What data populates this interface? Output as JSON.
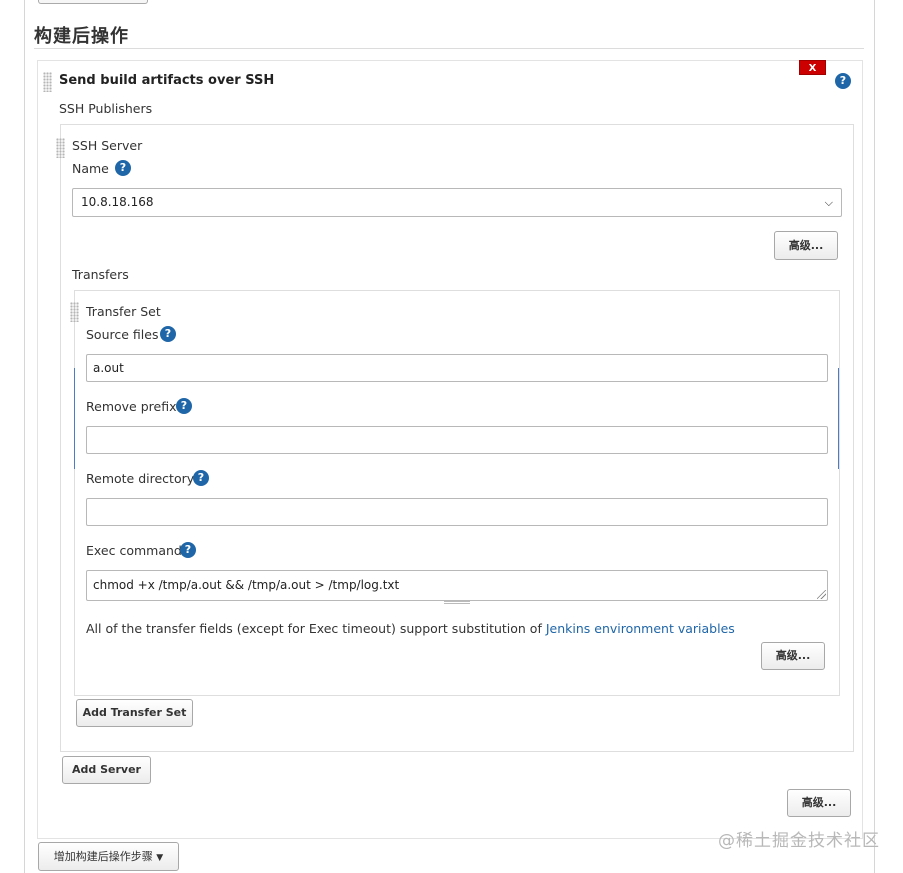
{
  "section": {
    "title": "构建后操作"
  },
  "publisher": {
    "title": "Send build artifacts over SSH",
    "delete_label": "X",
    "help": "?",
    "publishers_label": "SSH Publishers"
  },
  "ssh_server": {
    "title": "SSH Server",
    "name_label": "Name",
    "name_value": "10.8.18.168",
    "advanced_label": "高级..."
  },
  "transfers": {
    "label": "Transfers",
    "set_title": "Transfer Set",
    "source_files_label": "Source files",
    "source_files_value": "a.out",
    "remove_prefix_label": "Remove prefix",
    "remove_prefix_value": "",
    "remote_directory_label": "Remote directory",
    "remote_directory_value": "",
    "exec_command_label": "Exec command",
    "exec_command_value": "chmod +x /tmp/a.out && /tmp/a.out > /tmp/log.txt",
    "note_prefix": "All of the transfer fields (except for Exec timeout) support substitution of",
    "note_link": "Jenkins environment variables",
    "advanced_label": "高级...",
    "add_transfer_set_label": "Add Transfer Set"
  },
  "add_server_label": "Add Server",
  "outer_advanced_label": "高级...",
  "add_step_label": "增加构建后操作步骤",
  "watermark": "@稀土掘金技术社区",
  "colors": {
    "help": "#1f66a8",
    "delete": "#cc0000",
    "link": "#1f66a8"
  }
}
